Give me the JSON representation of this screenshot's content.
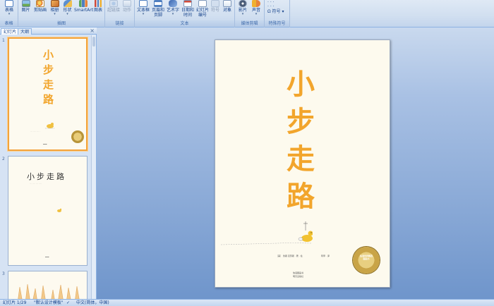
{
  "ribbon": {
    "groups": [
      {
        "label": "表格",
        "items": [
          {
            "label": "表格",
            "icon": "table-icon"
          }
        ]
      },
      {
        "label": "插图",
        "items": [
          {
            "label": "图片",
            "icon": "picture-icon"
          },
          {
            "label": "剪贴画",
            "icon": "clipart-icon"
          },
          {
            "label": "相册",
            "icon": "album-icon"
          },
          {
            "label": "形状",
            "icon": "shapes-icon"
          },
          {
            "label": "SmartArt",
            "icon": "smartart-icon"
          },
          {
            "label": "图表",
            "icon": "chart-icon"
          }
        ]
      },
      {
        "label": "链接",
        "items": [
          {
            "label": "超链接",
            "icon": "hyperlink-icon"
          },
          {
            "label": "动作",
            "icon": "action-icon"
          }
        ]
      },
      {
        "label": "文本",
        "items": [
          {
            "label": "文本框",
            "icon": "textbox-icon"
          },
          {
            "label": "页眉和",
            "label2": "页脚",
            "icon": "header-footer-icon"
          },
          {
            "label": "艺术字",
            "icon": "wordart-icon"
          },
          {
            "label": "日期和",
            "label2": "时间",
            "icon": "datetime-icon"
          },
          {
            "label": "幻灯片",
            "label2": "编号",
            "icon": "slide-number-icon"
          },
          {
            "label": "符号",
            "icon": "symbol-icon"
          },
          {
            "label": "对象",
            "icon": "object-icon"
          }
        ]
      },
      {
        "label": "媒体剪辑",
        "items": [
          {
            "label": "影片",
            "icon": "movie-icon"
          },
          {
            "label": "声音",
            "icon": "sound-icon"
          }
        ]
      },
      {
        "label": "特殊符号",
        "items": [
          {
            "label": "符号",
            "icon": "omega-icon"
          }
        ]
      }
    ]
  },
  "panel": {
    "tab_slides": "幻灯片",
    "tab_outline": "大纲",
    "close": "×",
    "thumb_numbers": [
      "1",
      "2",
      "3"
    ],
    "thumb2_title": "小步走路"
  },
  "slide": {
    "title_chars": [
      "小",
      "步",
      "走",
      "路"
    ],
    "author_line": "［美］ 鲁斯·克劳斯 · 著 · 绘",
    "translator": "阿甲 · 译",
    "publisher": "明天出版社",
    "publisher_sub": "信谊图画书",
    "badge_text": "信谊世界精选图画书",
    "badge_color": "#c9a447",
    "title_color": "#f2a52c"
  },
  "status": {
    "slide_counter": "幻灯片 1/29",
    "theme": "\"默认设计模板\"",
    "language": "中文(简体，中国)"
  }
}
